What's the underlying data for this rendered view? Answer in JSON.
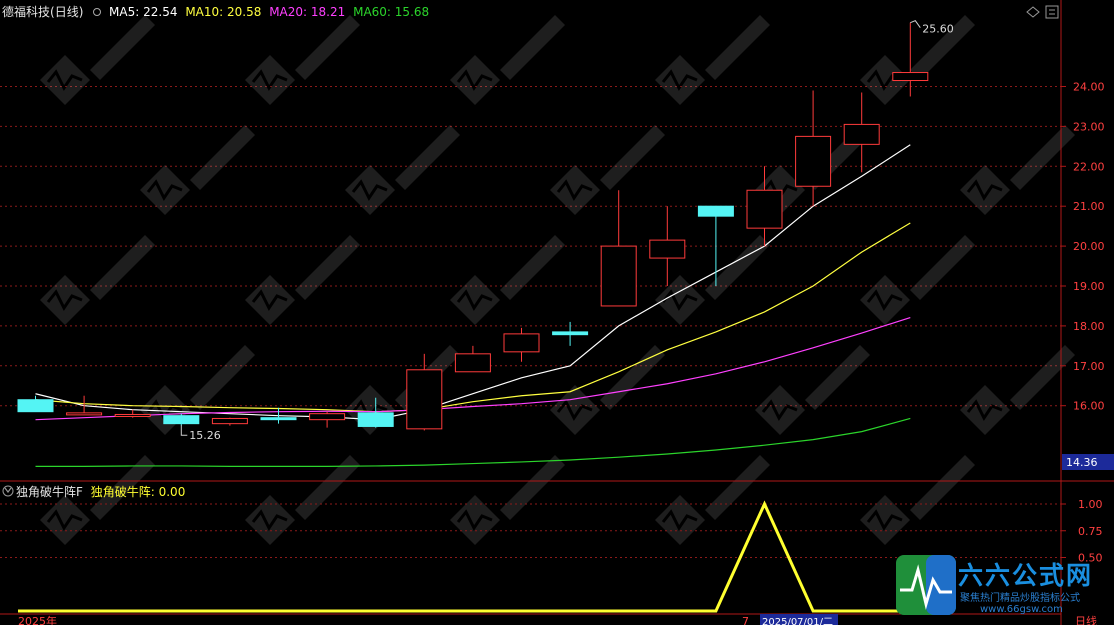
{
  "header": {
    "stock_name": "德福科技",
    "period": "(日线)",
    "ma5_label": "MA5:",
    "ma5_value": "22.54",
    "ma10_label": "MA10:",
    "ma10_value": "20.58",
    "ma20_label": "MA20:",
    "ma20_value": "18.21",
    "ma60_label": "MA60:",
    "ma60_value": "15.68"
  },
  "indicator": {
    "name": "独角破牛阵F",
    "series_label": "独角破牛阵:",
    "series_value": "0.00"
  },
  "footer": {
    "year_label": "2025年",
    "month_label": "7",
    "cursor_date": "2025/07/01/二",
    "period_label": "日线"
  },
  "current_price_label": "14.36",
  "colors": {
    "up": "#ff3b3b",
    "down": "#54f4f4",
    "ma5": "#ffffff",
    "ma10": "#ffff40",
    "ma20": "#ff40ff",
    "ma60": "#2bd42b",
    "indicator": "#ffff30",
    "grid": "#8b1a1a",
    "axis_text": "#ff4040"
  },
  "icons": [
    "diamond-icon",
    "toggle-panel-icon",
    "collapse-icon"
  ],
  "watermark": {
    "name": "六六公式网",
    "slogan": "聚焦热门精品炒股指标公式",
    "url": "www.66gsw.com"
  },
  "chart_data": [
    {
      "type": "candlestick",
      "title": "德福科技 (日线)",
      "y_axis_ticks": [
        16.0,
        17.0,
        18.0,
        19.0,
        20.0,
        21.0,
        22.0,
        23.0,
        24.0
      ],
      "ylim": [
        14.36,
        26.0
      ],
      "high_annotation": 25.6,
      "low_annotation": 15.26,
      "candles": [
        {
          "open": 16.15,
          "high": 16.25,
          "low": 15.85,
          "close": 15.85
        },
        {
          "open": 15.8,
          "high": 16.25,
          "low": 15.8,
          "close": 15.82
        },
        {
          "open": 15.75,
          "high": 15.9,
          "low": 15.7,
          "close": 15.78
        },
        {
          "open": 15.75,
          "high": 15.8,
          "low": 15.5,
          "close": 15.55
        },
        {
          "open": 15.55,
          "high": 15.7,
          "low": 15.5,
          "close": 15.68
        },
        {
          "open": 15.7,
          "high": 15.95,
          "low": 15.55,
          "close": 15.65
        },
        {
          "open": 15.65,
          "high": 15.85,
          "low": 15.45,
          "close": 15.8
        },
        {
          "open": 15.82,
          "high": 16.2,
          "low": 15.45,
          "close": 15.48
        },
        {
          "open": 15.42,
          "high": 17.3,
          "low": 15.38,
          "close": 16.9
        },
        {
          "open": 16.85,
          "high": 17.5,
          "low": 16.85,
          "close": 17.3
        },
        {
          "open": 17.35,
          "high": 17.95,
          "low": 17.1,
          "close": 17.8
        },
        {
          "open": 17.85,
          "high": 18.1,
          "low": 17.5,
          "close": 17.78
        },
        {
          "open": 18.5,
          "high": 21.4,
          "low": 18.5,
          "close": 20.0
        },
        {
          "open": 19.7,
          "high": 21.0,
          "low": 19.0,
          "close": 20.15
        },
        {
          "open": 21.0,
          "high": 21.0,
          "low": 19.0,
          "close": 20.75
        },
        {
          "open": 20.45,
          "high": 22.0,
          "low": 20.0,
          "close": 21.4
        },
        {
          "open": 21.5,
          "high": 23.9,
          "low": 21.0,
          "close": 22.75
        },
        {
          "open": 22.55,
          "high": 23.85,
          "low": 21.85,
          "close": 23.05
        },
        {
          "open": 24.15,
          "high": 25.6,
          "low": 23.75,
          "close": 24.35
        }
      ],
      "series": [
        {
          "name": "MA5",
          "values": [
            16.3,
            16.0,
            15.9,
            15.85,
            15.8,
            15.75,
            15.72,
            15.65,
            15.9,
            16.3,
            16.7,
            17.0,
            18.0,
            18.7,
            19.35,
            20.0,
            21.0,
            21.75,
            22.54
          ]
        },
        {
          "name": "MA10",
          "values": [
            16.15,
            16.05,
            16.0,
            15.98,
            15.95,
            15.93,
            15.9,
            15.85,
            15.9,
            16.1,
            16.25,
            16.35,
            16.85,
            17.4,
            17.85,
            18.35,
            19.0,
            19.85,
            20.58
          ]
        },
        {
          "name": "MA20",
          "values": [
            15.65,
            15.7,
            15.75,
            15.8,
            15.83,
            15.85,
            15.86,
            15.85,
            15.9,
            15.98,
            16.05,
            16.15,
            16.35,
            16.55,
            16.8,
            17.1,
            17.45,
            17.82,
            18.21
          ]
        },
        {
          "name": "MA60",
          "values": [
            14.48,
            14.48,
            14.49,
            14.49,
            14.48,
            14.48,
            14.48,
            14.49,
            14.51,
            14.55,
            14.59,
            14.64,
            14.71,
            14.79,
            14.89,
            15.01,
            15.15,
            15.35,
            15.68
          ]
        }
      ]
    },
    {
      "type": "line",
      "title": "独角破牛阵F",
      "y_axis_ticks": [
        0.5,
        0.75,
        1.0
      ],
      "series": [
        {
          "name": "独角破牛阵",
          "values": [
            0,
            0,
            0,
            0,
            0,
            0,
            0,
            0,
            0,
            0,
            0,
            0,
            0,
            0,
            0,
            1,
            0,
            0,
            0
          ]
        }
      ]
    }
  ]
}
